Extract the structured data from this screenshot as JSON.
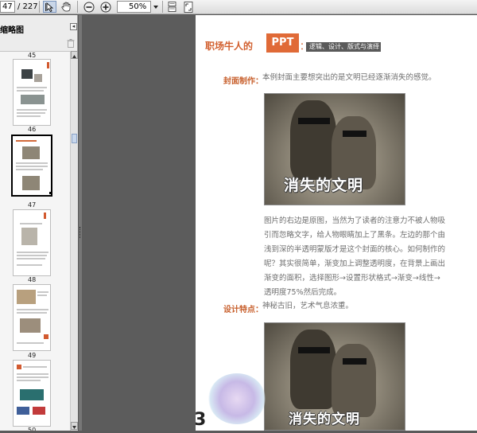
{
  "toolbar": {
    "current_page": "47",
    "total_pages": "/ 227",
    "zoom": "50%"
  },
  "sidebar": {
    "title": "缩略图",
    "close_glyph": "◂",
    "thumbnails": [
      {
        "label": "45",
        "selected": false
      },
      {
        "label": "46",
        "selected": false
      },
      {
        "label": "47",
        "selected": true
      },
      {
        "label": "48",
        "selected": false
      },
      {
        "label": "49",
        "selected": false
      },
      {
        "label": "50",
        "selected": false
      }
    ]
  },
  "page": {
    "header_left": "职场牛人的",
    "header_ppt": "PPT",
    "header_colon": "：",
    "header_right": "逻辑、设计、版式与演绎",
    "section1_label": "封面制作：",
    "section1_text": "本例封面主要想突出的是文明已经逐渐消失的感觉。",
    "image_caption": "消失的文明",
    "body_lines": [
      "图片的右边是原图，当然为了读者的注意力不被人物吸",
      "引而忽略文字，给人物眼睛加上了黑条。左边的那个由",
      "浅到深的半透明蒙版才是这个封面的核心。如何制作的",
      "呢？其实很简单，渐变加上调整透明度，在背景上画出",
      "渐变的面积，选择图形→设置形状格式→渐变→线性→",
      "透明度75%然后完成。"
    ],
    "section2_label": "设计特点：",
    "section2_text": "神秘古旧，艺术气息浓重。",
    "page_number_partial": "3"
  },
  "colors": {
    "accent": "#d2602f",
    "viewer_bg": "#5c5c5c",
    "toolbar_bg": "#e8e8e8"
  },
  "icons": [
    "select-cursor-icon",
    "hand-icon",
    "zoom-out-icon",
    "zoom-in-icon",
    "single-page-icon",
    "fit-page-icon",
    "trash-icon"
  ]
}
